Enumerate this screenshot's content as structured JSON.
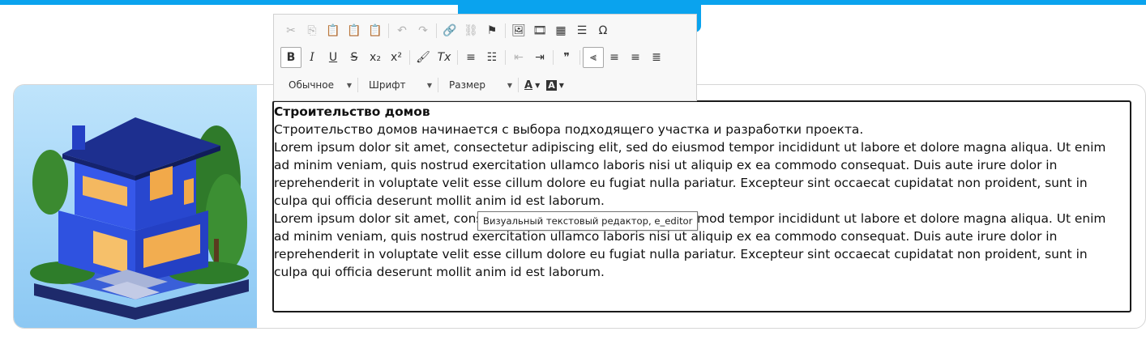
{
  "editor_toolbar": {
    "rows": [
      [
        {
          "name": "cut-icon",
          "glyph": "✂",
          "disabled": true
        },
        {
          "name": "copy-icon",
          "glyph": "⎘",
          "disabled": true
        },
        {
          "name": "paste-icon",
          "glyph": "📋",
          "disabled": false
        },
        {
          "name": "paste-text-icon",
          "glyph": "📋",
          "disabled": false
        },
        {
          "name": "paste-from-word-icon",
          "glyph": "📋",
          "disabled": false
        },
        {
          "sep": true
        },
        {
          "name": "undo-icon",
          "glyph": "↶",
          "disabled": true
        },
        {
          "name": "redo-icon",
          "glyph": "↷",
          "disabled": true
        },
        {
          "sep": true
        },
        {
          "name": "link-icon",
          "glyph": "🔗",
          "disabled": false
        },
        {
          "name": "unlink-icon",
          "glyph": "⛓",
          "disabled": true
        },
        {
          "name": "anchor-icon",
          "glyph": "⚑",
          "disabled": false
        },
        {
          "sep": true
        },
        {
          "name": "image-icon",
          "glyph": "🖼",
          "disabled": false
        },
        {
          "name": "video-icon",
          "glyph": "🎞",
          "disabled": false
        },
        {
          "name": "table-icon",
          "glyph": "▦",
          "disabled": false
        },
        {
          "name": "horizontal-line-icon",
          "glyph": "☰",
          "disabled": false
        },
        {
          "name": "special-char-icon",
          "glyph": "Ω",
          "disabled": false
        }
      ],
      [
        {
          "name": "bold-icon",
          "glyph": "B",
          "disabled": false,
          "active": true,
          "style": "font-weight:bold"
        },
        {
          "name": "italic-icon",
          "glyph": "I",
          "disabled": false,
          "style": "font-style:italic;font-family:'DejaVu Serif',serif"
        },
        {
          "name": "underline-icon",
          "glyph": "U",
          "disabled": false,
          "style": "text-decoration:underline"
        },
        {
          "name": "strikethrough-icon",
          "glyph": "S",
          "disabled": false,
          "style": "text-decoration:line-through"
        },
        {
          "name": "subscript-icon",
          "glyph": "x₂",
          "disabled": false
        },
        {
          "name": "superscript-icon",
          "glyph": "x²",
          "disabled": false
        },
        {
          "sep": true
        },
        {
          "name": "copy-format-icon",
          "glyph": "🖌",
          "disabled": false
        },
        {
          "name": "remove-format-icon",
          "glyph": "Tx",
          "disabled": false,
          "style": "font-style:italic"
        },
        {
          "sep": true
        },
        {
          "name": "numbered-list-icon",
          "glyph": "≡",
          "disabled": false
        },
        {
          "name": "bulleted-list-icon",
          "glyph": "☷",
          "disabled": false
        },
        {
          "sep": true
        },
        {
          "name": "outdent-icon",
          "glyph": "⇤",
          "disabled": true
        },
        {
          "name": "indent-icon",
          "glyph": "⇥",
          "disabled": false
        },
        {
          "sep": true
        },
        {
          "name": "blockquote-icon",
          "glyph": "❞",
          "disabled": false
        },
        {
          "sep": true
        },
        {
          "name": "align-left-icon",
          "glyph": "⫷",
          "disabled": false,
          "active": true
        },
        {
          "name": "align-center-icon",
          "glyph": "≡",
          "disabled": false
        },
        {
          "name": "align-right-icon",
          "glyph": "≡",
          "disabled": false
        },
        {
          "name": "justify-icon",
          "glyph": "≣",
          "disabled": false
        }
      ]
    ],
    "format_combo": "Обычное",
    "font_combo": "Шрифт",
    "size_combo": "Размер",
    "text_color_glyph": "A",
    "bg_color_glyph": "A"
  },
  "editor": {
    "heading": "Строительство домов",
    "paragraphs": [
      "Строительство домов начинается с выбора подходящего участка и разработки проекта.",
      "Lorem ipsum dolor sit amet, consectetur adipiscing elit, sed do eiusmod tempor incididunt ut labore et dolore magna aliqua. Ut enim ad minim veniam, quis nostrud exercitation ullamco laboris nisi ut aliquip ex ea commodo consequat. Duis aute irure dolor in reprehenderit in voluptate velit esse cillum dolore eu fugiat nulla pariatur. Excepteur sint occaecat cupidatat non proident, sunt in culpa qui officia deserunt mollit anim id est laborum.",
      "Lorem ipsum dolor sit amet, consectetur adipiscing elit, sed do eiusmod tempor incididunt ut labore et dolore magna aliqua. Ut enim ad minim veniam, quis nostrud exercitation ullamco laboris nisi ut aliquip ex ea commodo consequat. Duis aute irure dolor in reprehenderit in voluptate velit esse cillum dolore eu fugiat nulla pariatur. Excepteur sint occaecat cupidatat non proident, sunt in culpa qui officia deserunt mollit anim id est laborum."
    ],
    "tooltip": "Визуальный текстовый редактор, e_editor"
  },
  "colors": {
    "accent": "#0aa3ee",
    "house_blue": "#2f52e0"
  }
}
